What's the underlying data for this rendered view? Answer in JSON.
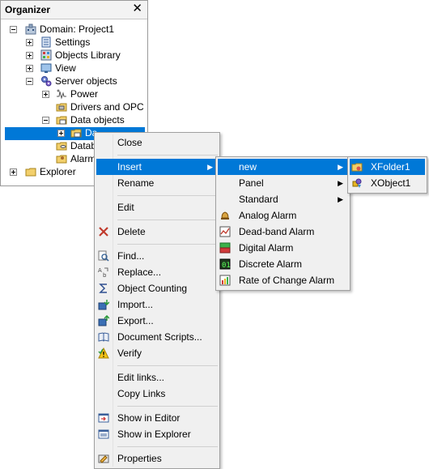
{
  "organizer": {
    "title": "Organizer",
    "close_glyph": "✕",
    "tree": [
      {
        "label": "Domain: Project1",
        "icon": "domain-icon"
      },
      {
        "label": "Settings",
        "icon": "settings-icon"
      },
      {
        "label": "Objects Library",
        "icon": "library-icon"
      },
      {
        "label": "View",
        "icon": "view-icon"
      },
      {
        "label": "Server objects",
        "icon": "gears-icon"
      },
      {
        "label": "Power",
        "icon": "power-icon"
      },
      {
        "label": "Drivers and OPC",
        "icon": "drivers-icon"
      },
      {
        "label": "Data objects",
        "icon": "data-objects-icon"
      },
      {
        "label": "Da",
        "icon": "database-folder-icon"
      },
      {
        "label": "Datab",
        "icon": "database-icon"
      },
      {
        "label": "Alarms",
        "icon": "alarms-icon"
      },
      {
        "label": "Explorer",
        "icon": "folder-icon"
      }
    ]
  },
  "context_menu": {
    "items": [
      {
        "label": "Close"
      },
      {
        "label": "Insert"
      },
      {
        "label": "Rename"
      },
      {
        "label": "Edit"
      },
      {
        "label": "Delete"
      },
      {
        "label": "Find..."
      },
      {
        "label": "Replace..."
      },
      {
        "label": "Object Counting"
      },
      {
        "label": "Import..."
      },
      {
        "label": "Export..."
      },
      {
        "label": "Document Scripts..."
      },
      {
        "label": "Verify"
      },
      {
        "label": "Edit links..."
      },
      {
        "label": "Copy Links"
      },
      {
        "label": "Show in Editor"
      },
      {
        "label": "Show in Explorer"
      },
      {
        "label": "Properties"
      }
    ]
  },
  "insert_menu": {
    "items": [
      {
        "label": "new"
      },
      {
        "label": "Panel"
      },
      {
        "label": "Standard"
      },
      {
        "label": "Analog Alarm"
      },
      {
        "label": "Dead-band Alarm"
      },
      {
        "label": "Digital Alarm"
      },
      {
        "label": "Discrete Alarm"
      },
      {
        "label": "Rate of Change Alarm"
      }
    ]
  },
  "new_menu": {
    "items": [
      {
        "label": "XFolder1"
      },
      {
        "label": "XObject1"
      }
    ]
  },
  "colors": {
    "highlight": "#0078d7",
    "menu_bg": "#f0f0f0"
  }
}
